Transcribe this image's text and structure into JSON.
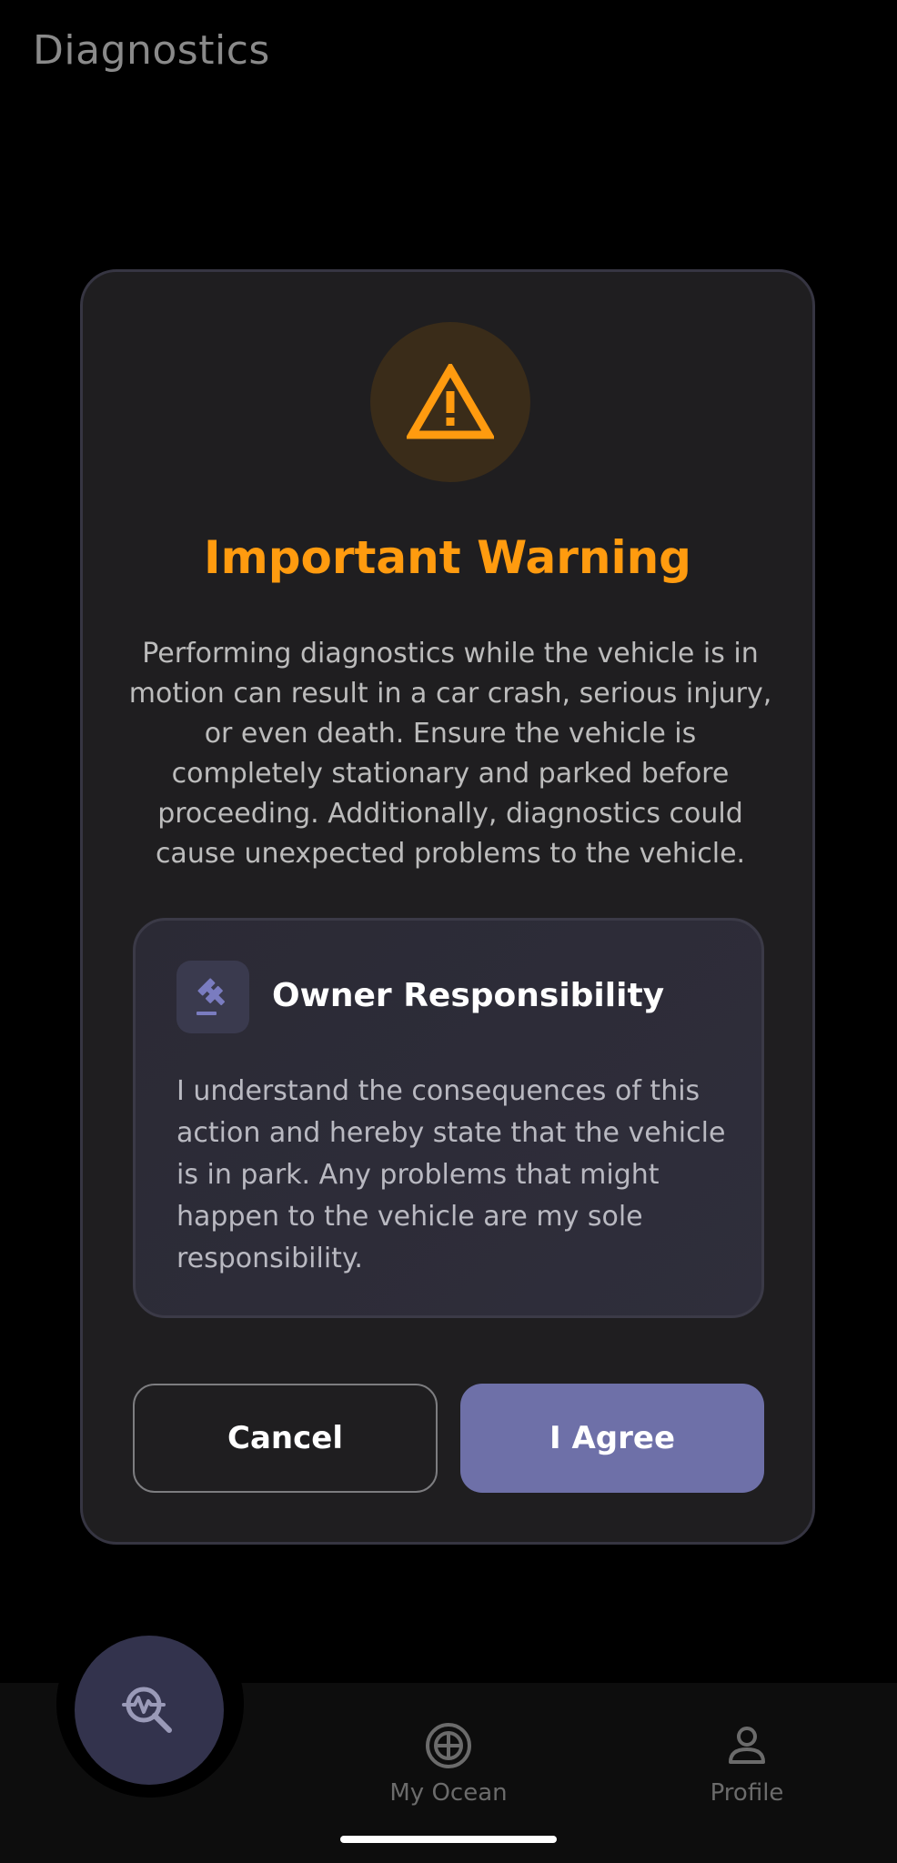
{
  "header": {
    "title": "Diagnostics"
  },
  "modal": {
    "icon": "warning-triangle-icon",
    "title": "Important Warning",
    "body": "Performing diagnostics while the vehicle is in motion can result in a car crash, serious injury, or even death. Ensure the vehicle is completely stationary and parked before proceeding. Additionally, diagnostics could cause unexpected problems to the vehicle.",
    "responsibility": {
      "icon": "gavel-icon",
      "title": "Owner Responsibility",
      "body": "I understand the consequences of this action and hereby state that the vehicle is in park. Any problems that might happen to the vehicle are my sole responsibility."
    },
    "cancel_label": "Cancel",
    "agree_label": "I Agree"
  },
  "bottom_nav": {
    "fab_icon": "diagnostics-search-icon",
    "items": [
      {
        "label": "My Ocean",
        "icon": "ocean-globe-icon"
      },
      {
        "label": "Profile",
        "icon": "person-icon"
      }
    ]
  },
  "colors": {
    "accent_warning": "#ff9b0f",
    "primary_button": "#6e70a8",
    "background": "#000000",
    "modal_background": "#1f1e20"
  }
}
